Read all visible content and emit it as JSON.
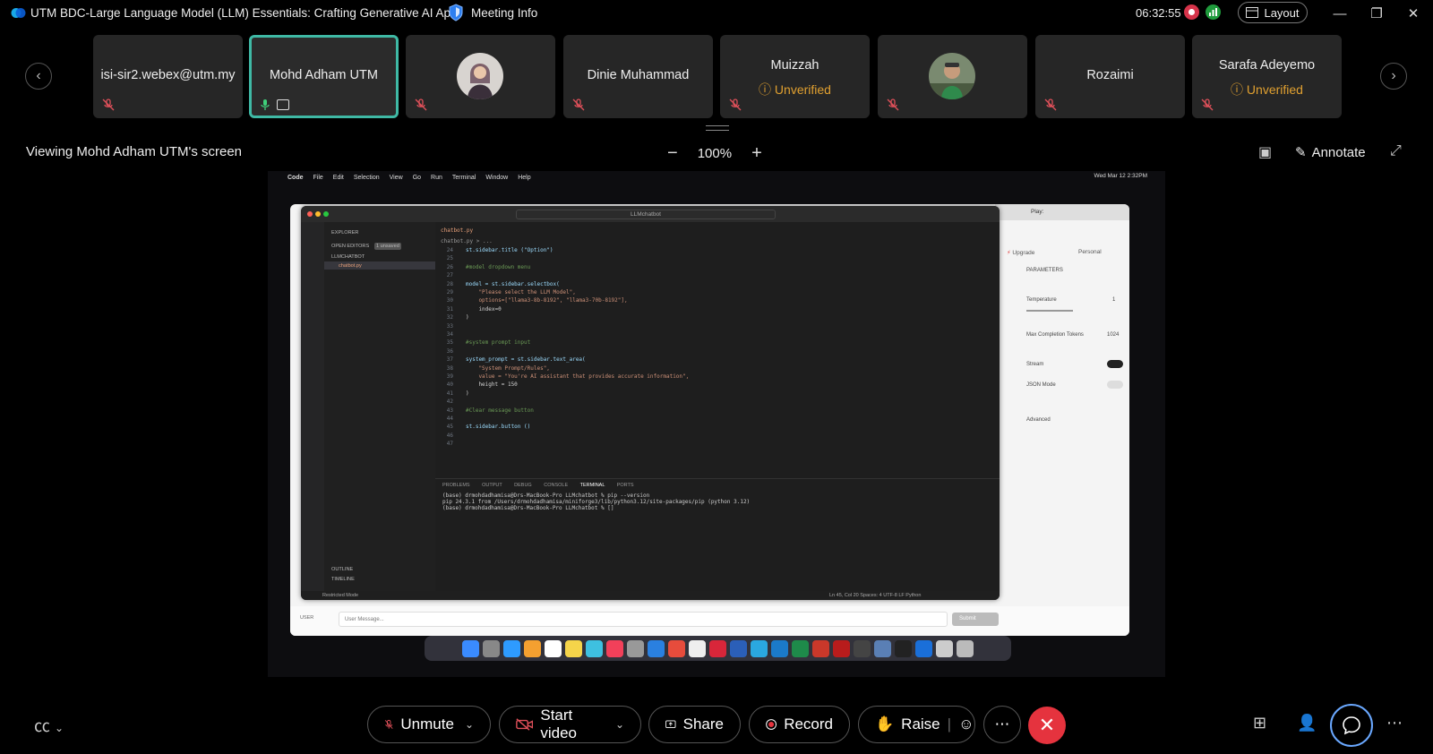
{
  "window": {
    "title": "UTM BDC-Large Language Model (LLM) Essentials: Crafting Generative AI Ap...",
    "meeting_info_label": "Meeting Info",
    "clock": "06:32:55",
    "layout_label": "Layout"
  },
  "participants": [
    {
      "name": "isi-sir2.webex@utm.my",
      "muted": true
    },
    {
      "name": "Mohd Adham UTM",
      "muted": false,
      "active_speaker": true,
      "sharing": true
    },
    {
      "name": "",
      "muted": true,
      "has_photo": true
    },
    {
      "name": "Dinie Muhammad",
      "muted": true
    },
    {
      "name": "Muizzah",
      "badge": "Unverified",
      "muted": true
    },
    {
      "name": "",
      "muted": true,
      "has_photo": true
    },
    {
      "name": "Rozaimi",
      "muted": true
    },
    {
      "name": "Sarafa Adeyemo",
      "badge": "Unverified",
      "muted": true
    }
  ],
  "share_toolbar": {
    "viewing_label": "Viewing Mohd Adham UTM's screen",
    "zoom_level": "100%",
    "annotate_label": "Annotate"
  },
  "shared_screen": {
    "mac_menu": [
      "Code",
      "File",
      "Edit",
      "Selection",
      "View",
      "Go",
      "Run",
      "Terminal",
      "Window",
      "Help"
    ],
    "mac_datetime": "Wed Mar 12  2:32PM",
    "vscode": {
      "search_text": "LLMchatbot",
      "explorer_title": "EXPLORER",
      "open_editors": "OPEN EDITORS",
      "unsaved_badge": "1 unsaved",
      "folder": "LLMCHATBOT",
      "file": "chatbot.py",
      "tab": "chatbot.py",
      "breadcrumb": "chatbot.py > ...",
      "outline": "OUTLINE",
      "timeline": "TIMELINE",
      "code_lines": [
        {
          "n": "24",
          "t": "st.sidebar.title (\"Option\")"
        },
        {
          "n": "25",
          "t": ""
        },
        {
          "n": "26",
          "t": "#model dropdown menu"
        },
        {
          "n": "27",
          "t": ""
        },
        {
          "n": "28",
          "t": "model = st.sidebar.selectbox("
        },
        {
          "n": "29",
          "t": "    \"Please select the LLM Model\","
        },
        {
          "n": "30",
          "t": "    options=[\"llama3-8b-8192\", \"llama3-70b-8192\"],"
        },
        {
          "n": "31",
          "t": "    index=0"
        },
        {
          "n": "32",
          "t": ")"
        },
        {
          "n": "33",
          "t": ""
        },
        {
          "n": "34",
          "t": ""
        },
        {
          "n": "35",
          "t": "#system prompt input"
        },
        {
          "n": "36",
          "t": ""
        },
        {
          "n": "37",
          "t": "system_prompt = st.sidebar.text_area("
        },
        {
          "n": "38",
          "t": "    \"System Prompt/Rules\","
        },
        {
          "n": "39",
          "t": "    value = \"You're AI assistant that provides accurate information\","
        },
        {
          "n": "40",
          "t": "    height = 150"
        },
        {
          "n": "41",
          "t": ")"
        },
        {
          "n": "42",
          "t": ""
        },
        {
          "n": "43",
          "t": "#Clear message button"
        },
        {
          "n": "44",
          "t": ""
        },
        {
          "n": "45",
          "t": "st.sidebar.button ()"
        },
        {
          "n": "46",
          "t": ""
        },
        {
          "n": "47",
          "t": ""
        }
      ],
      "panel_tabs": [
        "PROBLEMS",
        "OUTPUT",
        "DEBUG CONSOLE",
        "TERMINAL",
        "PORTS"
      ],
      "terminal_lines": [
        "(base) drmohdadhamisa@Drs-MacBook-Pro LLMchatbot % pip --version",
        "pip 24.3.1 from /Users/drmohdadhamisa/miniforge3/lib/python3.12/site-packages/pip (python 3.12)",
        "(base) drmohdadhamisa@Drs-MacBook-Pro LLMchatbot % []"
      ],
      "status_left": "Restricted Mode",
      "status_right": "Ln 45, Col 20   Spaces: 4   UTF-8   LF   Python"
    },
    "playground": {
      "upgrade": "Upgrade",
      "personal": "Personal",
      "parameters": "PARAMETERS",
      "temperature_label": "Temperature",
      "temperature_value": "1",
      "max_tokens_label": "Max Completion Tokens",
      "max_tokens_value": "1024",
      "stream_label": "Stream",
      "stream_on": true,
      "json_mode_label": "JSON Mode",
      "json_mode_on": false,
      "advanced_label": "Advanced",
      "user_label": "USER",
      "message_placeholder": "User Message...",
      "submit_label": "Submit"
    }
  },
  "controls": {
    "unmute": "Unmute",
    "start_video": "Start video",
    "share": "Share",
    "record": "Record",
    "raise": "Raise"
  },
  "colors": {
    "active_border": "#3fb9a5",
    "unverified": "#e0a030",
    "end_call": "#e5333e"
  }
}
